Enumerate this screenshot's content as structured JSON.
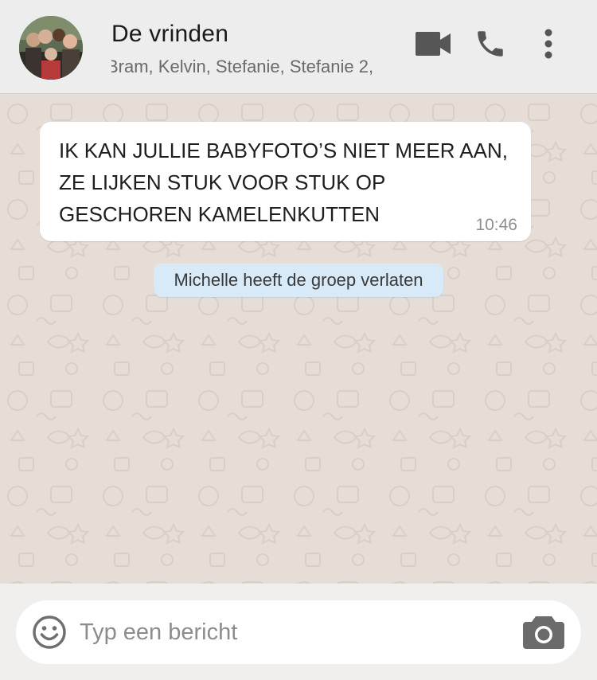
{
  "header": {
    "title": "De vrinden",
    "members": "Bram, Kelvin, Stefanie, Stefanie 2,",
    "icons": [
      "video-call-icon",
      "phone-icon",
      "more-options-icon"
    ]
  },
  "messages": [
    {
      "text": "IK KAN JULLIE BABYFOTO’S NIET MEER AAN,\nZE LIJKEN STUK VOOR STUK OP\nGESCHOREN KAMELENKUTTEN",
      "time": "10:46"
    }
  ],
  "system_message": "Michelle heeft de groep verlaten",
  "composer": {
    "placeholder": "Typ een bericht",
    "value": "",
    "icons": [
      "emoji-icon",
      "camera-icon"
    ]
  },
  "colors": {
    "header_bg": "#ededed",
    "chat_bg": "#e6ded6",
    "bubble_bg": "#ffffff",
    "system_bg": "#d8eaf7",
    "icon": "#565656"
  }
}
